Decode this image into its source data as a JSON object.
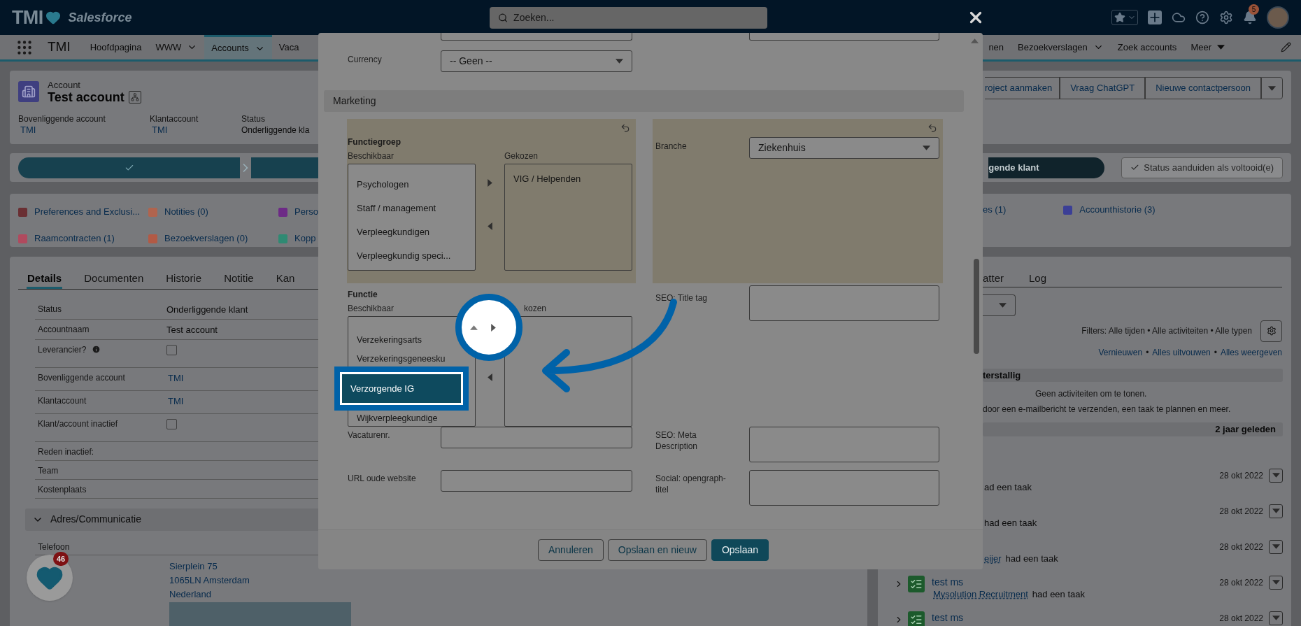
{
  "top_bar": {
    "logo": "TMI",
    "logo_sub": "Salesforce",
    "search": {
      "placeholder": "Zoeken..."
    },
    "notifications": "5"
  },
  "nav": {
    "app": "TMI",
    "items": [
      {
        "label": "Hoofdpagina",
        "kind": "plain",
        "selected": false
      },
      {
        "label": "WWW",
        "kind": "chevron",
        "selected": false
      },
      {
        "label": "Accounts",
        "kind": "chevron",
        "selected": true
      },
      {
        "label": "Vaca",
        "kind": "plain",
        "selected": false
      }
    ],
    "items_right": [
      {
        "label": "nen",
        "kind": "plain",
        "selected": false
      },
      {
        "label": "Bezoekverslagen",
        "kind": "chevron",
        "selected": false
      },
      {
        "label": "Zoek accounts",
        "kind": "plain",
        "selected": false
      },
      {
        "label": "Meer",
        "kind": "triangle",
        "selected": false
      }
    ]
  },
  "record": {
    "type": "Account",
    "name": "Test account",
    "fields": [
      {
        "label": "Bovenliggende account",
        "value": "TMI",
        "kind": "link"
      },
      {
        "label": "Klantaccount",
        "value": "TMI",
        "kind": "link"
      },
      {
        "label": "Status",
        "value": "Onderliggende kla",
        "kind": "text"
      }
    ],
    "actions": [
      "roject aanmaken",
      "Vraag ChatGPT",
      "Nieuwe contactpersoon"
    ]
  },
  "path": {
    "current_button": "gende klant",
    "complete_button": "Status aanduiden als voltooid(e)",
    "complete_disabled": true
  },
  "related": {
    "items": [
      {
        "label": "Preferences and Exclusi...",
        "color": "#6a2f33"
      },
      {
        "label": "Notities (0)",
        "color": "#b0644e"
      },
      {
        "label": "Perso",
        "color": "#6d2a86"
      },
      {
        "label": "Raamcontracten (1)",
        "color": "#b04a5e"
      },
      {
        "label": "Bezoekverslagen (0)",
        "color": "#b25a45"
      },
      {
        "label": "Kopp",
        "color": "#2f8a73"
      }
    ],
    "items_right": [
      {
        "label": "es (1)"
      },
      {
        "label": "Accounthistorie (3)",
        "color": "#3b3f96"
      }
    ]
  },
  "details": {
    "tabs": [
      {
        "label": "Details",
        "selected": true
      },
      {
        "label": "Documenten",
        "selected": false
      },
      {
        "label": "Historie",
        "selected": false
      },
      {
        "label": "Notitie",
        "selected": false
      },
      {
        "label": "Kan",
        "selected": false
      }
    ],
    "fields": [
      {
        "label": "Status",
        "kind": "text",
        "value": "Onderliggende klant"
      },
      {
        "label": "Accountnaam",
        "kind": "text",
        "value": "Test account"
      },
      {
        "label": "Leverancier?",
        "kind": "checkbox",
        "checked": false,
        "info": true
      },
      {
        "label": "Bovenliggende account",
        "kind": "link",
        "value": "TMI"
      },
      {
        "label": "Klantaccount",
        "kind": "link",
        "value": "TMI"
      },
      {
        "label": "Klant/account inactief",
        "kind": "checkbox",
        "checked": false
      },
      {
        "label": "Reden inactief:",
        "kind": "text"
      },
      {
        "label": "Team",
        "kind": "text"
      },
      {
        "label": "Kostenplaats",
        "kind": "text"
      }
    ],
    "section": {
      "title": "Adres/Communicatie",
      "expanded": true
    },
    "address_fields": [
      {
        "label": "Telefoon"
      }
    ],
    "address": [
      "Sierplein 75",
      "1065LN Amsterdam",
      "Nederland"
    ]
  },
  "widget": {
    "badge": "46"
  },
  "activity": {
    "tabs": [
      {
        "label": "atter",
        "selected": false
      },
      {
        "label": "Log",
        "selected": false
      }
    ],
    "filters": "Filters: Alle tijden • Alle activiteiten • Alle typen",
    "links": [
      "Vernieuwen",
      "Alles uitvouwen",
      "Alles weergeven"
    ],
    "separator": "•",
    "overdue_header": "terstallig",
    "empty": "Geen activiteiten om te tonen.",
    "hint": "door een e-mailbericht te verzenden, een taak te plannen en meer.",
    "group": "2 jaar geleden",
    "items": [
      {
        "text": "ad een taak",
        "date": "28 okt 2022"
      },
      {
        "text": "had een taak",
        "date": "28 okt 2022"
      },
      {
        "who": "eijer",
        "text": "had een taak",
        "date": "28 okt 2022"
      },
      {
        "title": "test ms",
        "who": "Mysolution Recruitment",
        "text": "had een taak",
        "date": "28 okt 2022"
      },
      {
        "title": "test ms",
        "date": "28 okt 2022"
      }
    ]
  },
  "modal": {
    "currency": {
      "label": "Currency",
      "value": "-- Geen --"
    },
    "section": "Marketing",
    "functiegroep": {
      "label": "Functiegroep",
      "available_label": "Beschikbaar",
      "chosen_label": "Gekozen",
      "available": [
        {
          "label": "Psychologen",
          "selected": false
        },
        {
          "label": "Staff / management",
          "selected": false
        },
        {
          "label": "Verpleegkundigen",
          "selected": false
        },
        {
          "label": "Verpleegkundig speci...",
          "selected": false
        }
      ],
      "chosen": [
        {
          "label": "VIG / Helpenden",
          "selected": false
        }
      ]
    },
    "branche": {
      "label": "Branche",
      "value": "Ziekenhuis"
    },
    "functie": {
      "label": "Functie",
      "available_label": "Beschikbaar",
      "chosen_label": "kozen",
      "available": [
        {
          "label": "Verzekeringsarts",
          "selected": false
        },
        {
          "label": "Verzekeringsgeneesku",
          "selected": false
        },
        {
          "label": "Verzorgende IG",
          "selected": true
        },
        {
          "label": "Wijkverpleegkundige",
          "selected": false
        }
      ]
    },
    "seo_title": {
      "label": "SEO: Title tag"
    },
    "rows": [
      {
        "left": {
          "label": "Vacaturenr.",
          "kind": "input"
        },
        "right": {
          "label": "SEO: Meta Description",
          "kind": "textarea"
        }
      },
      {
        "left": {
          "label": "URL oude website",
          "kind": "input"
        },
        "right": {
          "label": "Social: opengraph-titel",
          "kind": "textarea"
        }
      }
    ],
    "buttons": [
      {
        "label": "Annuleren",
        "kind": "neutral"
      },
      {
        "label": "Opslaan en nieuw",
        "kind": "neutral"
      },
      {
        "label": "Opslaan",
        "kind": "brand"
      }
    ]
  }
}
